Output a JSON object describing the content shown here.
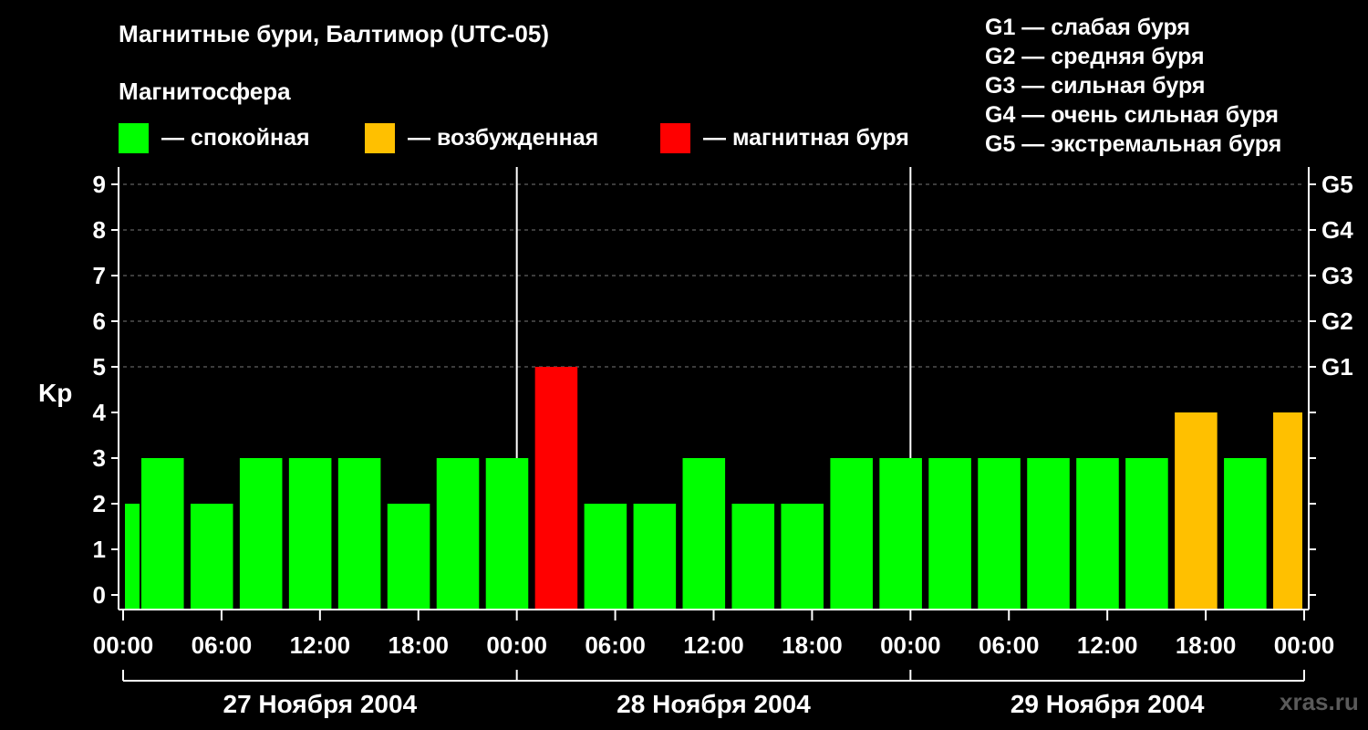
{
  "title": "Магнитные бури, Балтимор (UTC-05)",
  "legend": {
    "heading": "Магнитосфера",
    "items": [
      {
        "label": "— спокойная",
        "color": "#00ff00"
      },
      {
        "label": "— возбужденная",
        "color": "#ffc000"
      },
      {
        "label": "— магнитная буря",
        "color": "#ff0000"
      }
    ]
  },
  "storm_scale": [
    "G1 — слабая буря",
    "G2 — средняя буря",
    "G3 — сильная буря",
    "G4 — очень сильная буря",
    "G5 — экстремальная буря"
  ],
  "watermark": "xras.ru",
  "chart_data": {
    "type": "bar",
    "title": "Магнитные бури, Балтимор (UTC-05)",
    "ylabel": "Kp",
    "ylim": [
      0,
      9
    ],
    "yticks": [
      0,
      1,
      2,
      3,
      4,
      5,
      6,
      7,
      8,
      9
    ],
    "y2ticks": [
      {
        "value": 5,
        "label": "G1"
      },
      {
        "value": 6,
        "label": "G2"
      },
      {
        "value": 7,
        "label": "G3"
      },
      {
        "value": 8,
        "label": "G4"
      },
      {
        "value": 9,
        "label": "G5"
      }
    ],
    "xlim_hours": [
      0,
      72
    ],
    "xticks": [
      {
        "hour": 0,
        "label": "00:00"
      },
      {
        "hour": 6,
        "label": "06:00"
      },
      {
        "hour": 12,
        "label": "12:00"
      },
      {
        "hour": 18,
        "label": "18:00"
      },
      {
        "hour": 24,
        "label": "00:00"
      },
      {
        "hour": 30,
        "label": "06:00"
      },
      {
        "hour": 36,
        "label": "12:00"
      },
      {
        "hour": 42,
        "label": "18:00"
      },
      {
        "hour": 48,
        "label": "00:00"
      },
      {
        "hour": 54,
        "label": "06:00"
      },
      {
        "hour": 60,
        "label": "12:00"
      },
      {
        "hour": 66,
        "label": "18:00"
      },
      {
        "hour": 72,
        "label": "00:00"
      }
    ],
    "days": [
      {
        "label": "27 Ноября 2004",
        "start": 0,
        "end": 24
      },
      {
        "label": "28 Ноября 2004",
        "start": 24,
        "end": 48
      },
      {
        "label": "29 Ноября 2004",
        "start": 48,
        "end": 72
      }
    ],
    "grid": "horizontal-dashed",
    "bar_width_hours": 2.7,
    "colors": {
      "quiet": "#00ff00",
      "active": "#ffc000",
      "storm": "#ff0000"
    },
    "bars": [
      {
        "start": 0,
        "end": 1,
        "kp": 2,
        "level": "quiet"
      },
      {
        "start": 1,
        "end": 4,
        "kp": 3,
        "level": "quiet"
      },
      {
        "start": 4,
        "end": 7,
        "kp": 2,
        "level": "quiet"
      },
      {
        "start": 7,
        "end": 10,
        "kp": 3,
        "level": "quiet"
      },
      {
        "start": 10,
        "end": 13,
        "kp": 3,
        "level": "quiet"
      },
      {
        "start": 13,
        "end": 16,
        "kp": 3,
        "level": "quiet"
      },
      {
        "start": 16,
        "end": 19,
        "kp": 2,
        "level": "quiet"
      },
      {
        "start": 19,
        "end": 22,
        "kp": 3,
        "level": "quiet"
      },
      {
        "start": 22,
        "end": 25,
        "kp": 3,
        "level": "quiet"
      },
      {
        "start": 25,
        "end": 28,
        "kp": 5,
        "level": "storm"
      },
      {
        "start": 28,
        "end": 31,
        "kp": 2,
        "level": "quiet"
      },
      {
        "start": 31,
        "end": 34,
        "kp": 2,
        "level": "quiet"
      },
      {
        "start": 34,
        "end": 37,
        "kp": 3,
        "level": "quiet"
      },
      {
        "start": 37,
        "end": 40,
        "kp": 2,
        "level": "quiet"
      },
      {
        "start": 40,
        "end": 43,
        "kp": 2,
        "level": "quiet"
      },
      {
        "start": 43,
        "end": 46,
        "kp": 3,
        "level": "quiet"
      },
      {
        "start": 46,
        "end": 49,
        "kp": 3,
        "level": "quiet"
      },
      {
        "start": 49,
        "end": 52,
        "kp": 3,
        "level": "quiet"
      },
      {
        "start": 52,
        "end": 55,
        "kp": 3,
        "level": "quiet"
      },
      {
        "start": 55,
        "end": 58,
        "kp": 3,
        "level": "quiet"
      },
      {
        "start": 58,
        "end": 61,
        "kp": 3,
        "level": "quiet"
      },
      {
        "start": 61,
        "end": 64,
        "kp": 3,
        "level": "quiet"
      },
      {
        "start": 64,
        "end": 67,
        "kp": 4,
        "level": "active"
      },
      {
        "start": 67,
        "end": 70,
        "kp": 3,
        "level": "quiet"
      },
      {
        "start": 70,
        "end": 72,
        "kp": 4,
        "level": "active"
      }
    ]
  }
}
